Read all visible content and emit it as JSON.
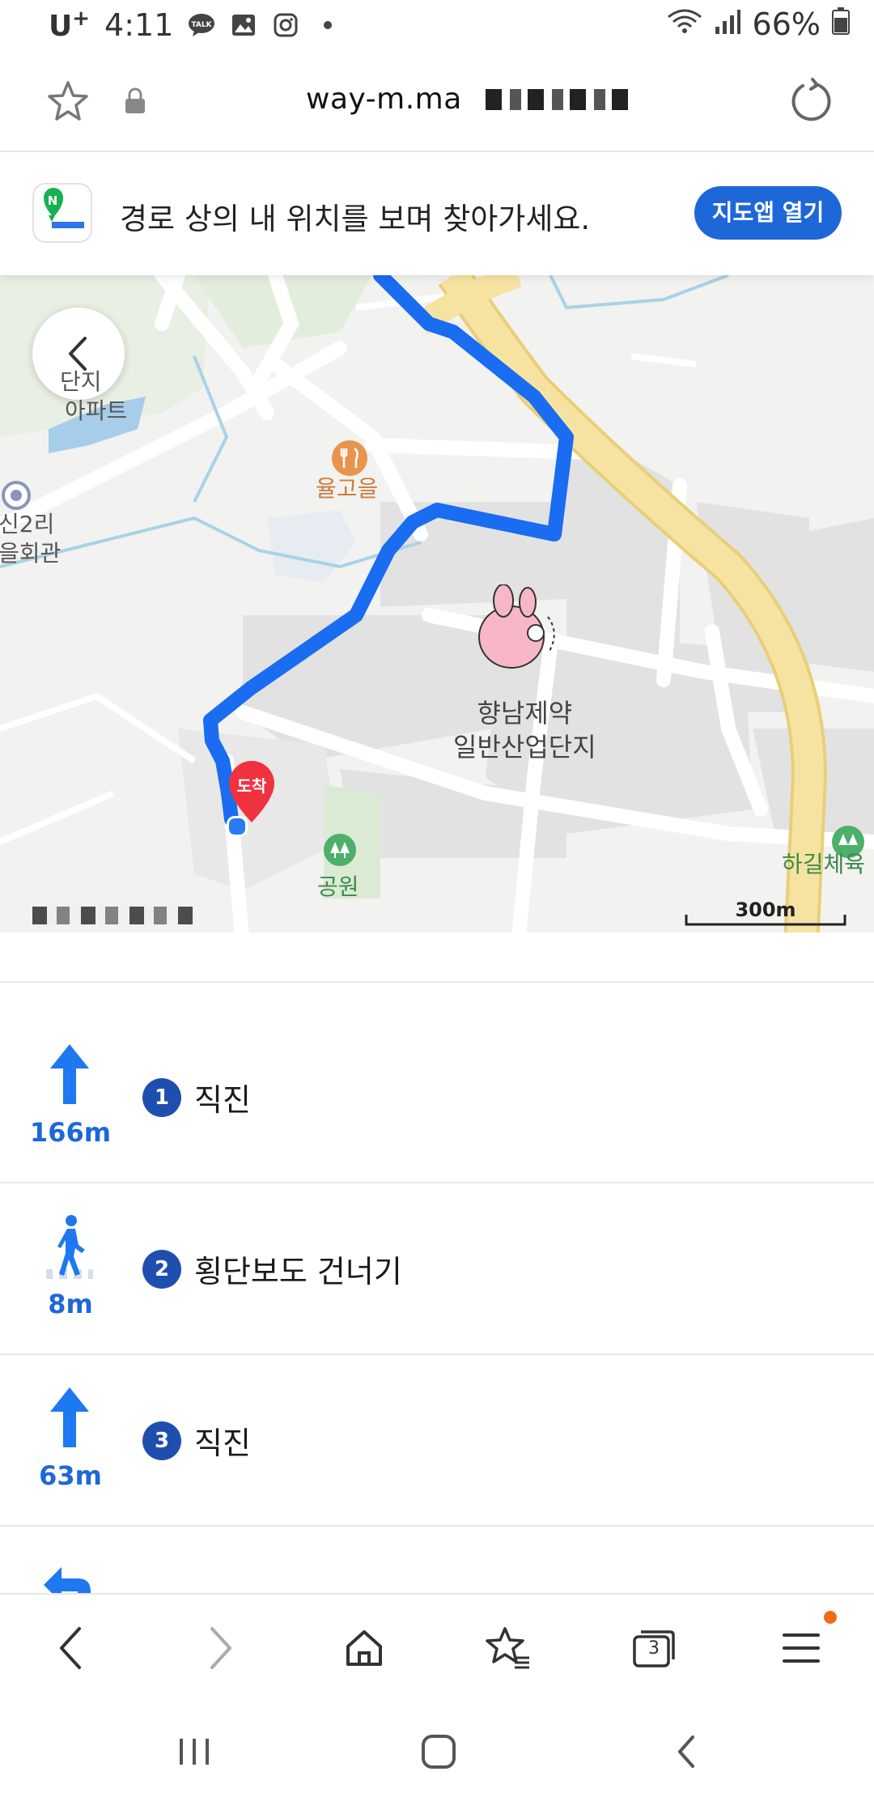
{
  "status_bar": {
    "carrier": "U",
    "carrier_sup": "+",
    "time": "4:11",
    "battery": "66%",
    "notification_icons": [
      "talk-icon",
      "gallery-icon",
      "instagram-icon"
    ]
  },
  "url_bar": {
    "url": "way-m.ma"
  },
  "banner": {
    "message": "경로 상의 내 위치를 보며 찾아가세요.",
    "button_label": "지도앱 열기",
    "logo_letter": "N"
  },
  "map": {
    "labels": {
      "apartment_1": "단지",
      "apartment_2": "아파트",
      "village_hall": "신2리\n을회관",
      "restaurant": "율고을",
      "industrial_complex": "향남제약\n일반산업단지",
      "park": "공원",
      "sports": "하길체육"
    },
    "destination_badge": "도착",
    "scale_label": "300m",
    "colors": {
      "route": "#1a6cf0",
      "highway": "#f7e3a1",
      "water": "#a6cdea",
      "block": "#e2e2e2"
    }
  },
  "steps": [
    {
      "num": "1",
      "label": "직진",
      "distance": "166m",
      "icon": "arrow-up-icon"
    },
    {
      "num": "2",
      "label": "횡단보도 건너기",
      "distance": "8m",
      "icon": "crosswalk-icon"
    },
    {
      "num": "3",
      "label": "직진",
      "distance": "63m",
      "icon": "arrow-up-icon"
    }
  ],
  "toolbar": {
    "tab_count": "3"
  }
}
